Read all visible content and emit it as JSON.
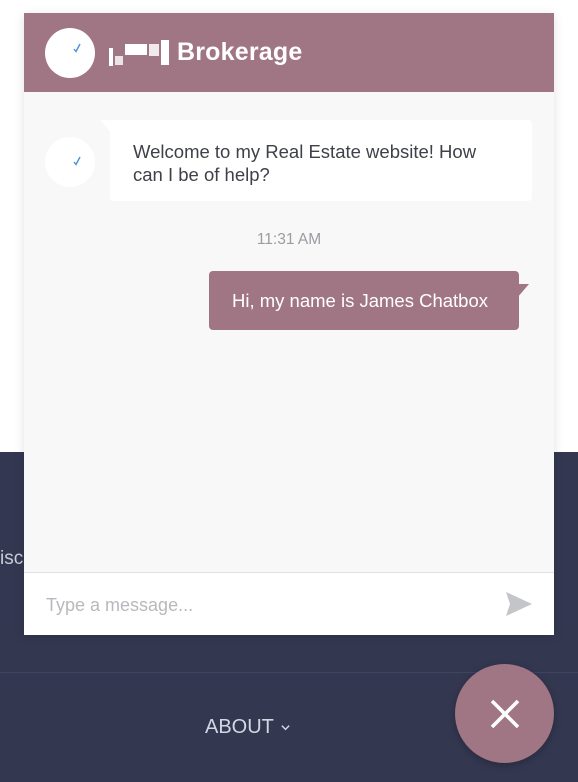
{
  "chat": {
    "brand_name": "Brokerage",
    "bot_message": "Welcome to my Real Estate website! How can I be of help?",
    "timestamp": "11:31 AM",
    "user_message": "Hi, my name is James Chatbox",
    "input_placeholder": "Type a message...",
    "icons": {
      "avatar": "check-icon",
      "send": "send-icon",
      "close": "close-icon"
    }
  },
  "footer": {
    "partial_text": "isc",
    "nav_about": "ABOUT"
  },
  "colors": {
    "accent": "#a07684",
    "footer_bg": "#333750",
    "chat_bg": "#f8f8f8",
    "check": "#4a90d9"
  }
}
